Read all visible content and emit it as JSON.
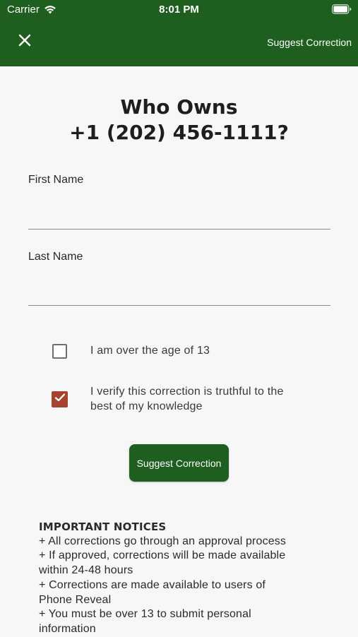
{
  "status_bar": {
    "carrier": "Carrier",
    "time": "8:01 PM",
    "wifi_icon": "wifi-icon",
    "battery_icon": "battery-icon"
  },
  "nav": {
    "close_icon": "close-icon",
    "action_label": "Suggest Correction"
  },
  "title": {
    "line1": "Who Owns",
    "line2": "+1 (202) 456-1111?"
  },
  "form": {
    "first_name_label": "First Name",
    "first_name_value": "",
    "last_name_label": "Last Name",
    "last_name_value": "",
    "age_checkbox": {
      "label": "I am over the age of 13",
      "checked": false
    },
    "verify_checkbox": {
      "label_line1": "I verify this correction is truthful to the",
      "label_line2": "best of my knowledge",
      "checked": true
    },
    "submit_label": "Suggest Correction"
  },
  "notices": {
    "heading": "IMPORTANT NOTICES",
    "lines": [
      "+ All corrections go through an approval process",
      "+ If approved, corrections will be made available",
      "within 24-48 hours",
      "+ Corrections are made available to users of",
      "Phone Reveal",
      "+ You must be over 13 to submit personal",
      "information"
    ]
  },
  "colors": {
    "brand_green": "#1e5e1e",
    "checkbox_checked": "#a5432e",
    "background": "#f7f7f7"
  }
}
